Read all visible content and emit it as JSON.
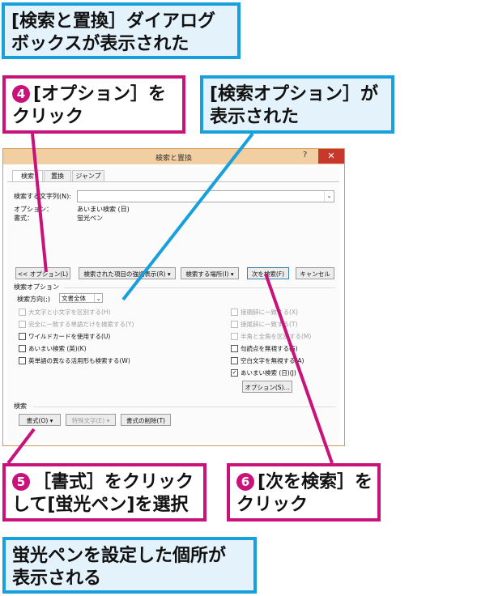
{
  "callouts": {
    "dialog_shown": [
      "[検索と置換］ダイアログ",
      "ボックスが表示された"
    ],
    "step4": {
      "num": "4",
      "lines": [
        "[オプション］を",
        "クリック"
      ]
    },
    "options_shown": [
      "[検索オプション］が",
      "表示された"
    ],
    "step5": {
      "num": "5",
      "lines": [
        "［書式］をクリック",
        "して[蛍光ペン]を選択"
      ]
    },
    "step6": {
      "num": "6",
      "lines": [
        "[次を検索］を",
        "クリック"
      ]
    },
    "result": [
      "蛍光ペンを設定した個所が",
      "表示される"
    ]
  },
  "dialog": {
    "title": "検索と置換",
    "help": "?",
    "close": "✕",
    "tabs": [
      "検索",
      "置換",
      "ジャンプ"
    ],
    "search_label": "検索する文字列(N):",
    "search_value": "",
    "option_label": "オプション：",
    "option_value": "あいまい検索 (日)",
    "format_label": "書式：",
    "format_value": "蛍光ペン",
    "buttons": {
      "options": "<< オプション(L)",
      "highlight": "検索された項目の強調表示(R) ▾",
      "search_in": "検索する場所(I) ▾",
      "find_next": "次を検索(F)",
      "cancel": "キャンセル"
    },
    "search_options_heading": "検索オプション",
    "direction_label": "検索方向(;)",
    "direction_value": "文書全体",
    "left_options": [
      {
        "label": "大文字と小文字を区別する(H)",
        "checked": false,
        "disabled": true
      },
      {
        "label": "完全に一致する単語だけを検索する(Y)",
        "checked": false,
        "disabled": true
      },
      {
        "label": "ワイルドカードを使用する(U)",
        "checked": false,
        "disabled": false
      },
      {
        "label": "あいまい検索 (英)(K)",
        "checked": false,
        "disabled": false
      },
      {
        "label": "英単語の異なる活用形も検索する(W)",
        "checked": false,
        "disabled": false
      }
    ],
    "right_options": [
      {
        "label": "接頭辞に一致する(X)",
        "checked": false,
        "disabled": true
      },
      {
        "label": "接尾辞に一致する(T)",
        "checked": false,
        "disabled": true
      },
      {
        "label": "半角と全角を区別する(M)",
        "checked": false,
        "disabled": true
      },
      {
        "label": "句読点を無視する(S)",
        "checked": false,
        "disabled": false
      },
      {
        "label": "空白文字を無視する(A)",
        "checked": false,
        "disabled": false
      },
      {
        "label": "あいまい検索 (日)(J)",
        "checked": true,
        "disabled": false
      }
    ],
    "fuzzy_options_button": "オプション(S)...",
    "search_section": "検索",
    "format_button": "書式(O) ▾",
    "special_button": "特殊文字(E) ▾",
    "clear_format_button": "書式の削除(T)"
  },
  "colors": {
    "blue": "#18a0dc",
    "pink": "#c8137a"
  }
}
